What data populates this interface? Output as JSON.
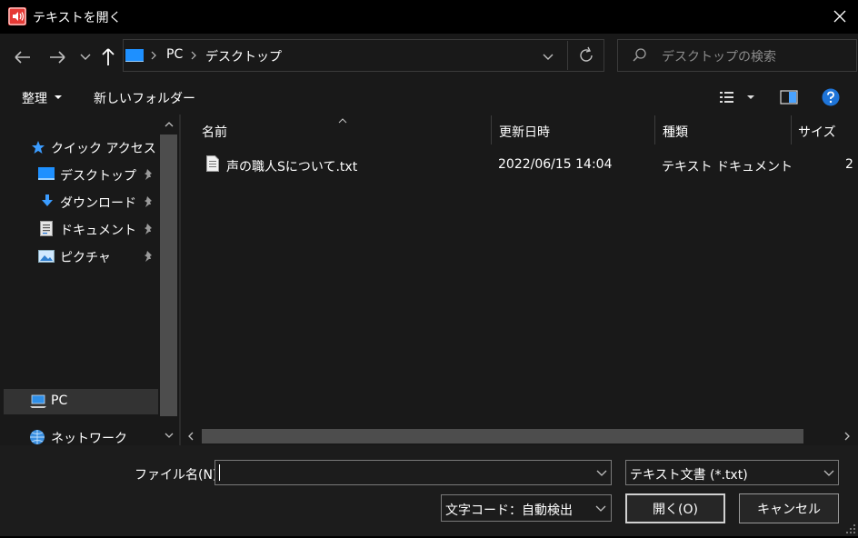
{
  "window": {
    "title": "テキストを開く"
  },
  "nav": {
    "breadcrumb": [
      "PC",
      "デスクトップ"
    ],
    "search_placeholder": "デスクトップの検索"
  },
  "toolbar": {
    "organize": "整理",
    "new_folder": "新しいフォルダー"
  },
  "sidebar": {
    "quick_access": "クイック アクセス",
    "items": [
      "デスクトップ",
      "ダウンロード",
      "ドキュメント",
      "ピクチャ"
    ],
    "pc": "PC",
    "network": "ネットワーク"
  },
  "columns": {
    "name": "名前",
    "date": "更新日時",
    "type": "種類",
    "size": "サイズ"
  },
  "files": [
    {
      "name": "声の職人Sについて.txt",
      "date": "2022/06/15 14:04",
      "type": "テキスト ドキュメント",
      "size": "2"
    }
  ],
  "bottom": {
    "filename_label": "ファイル名(N):",
    "filename_value": "",
    "filter": "テキスト文書 (*.txt)",
    "encoding": "文字コード：自動検出",
    "open": "開く(O)",
    "cancel": "キャンセル"
  }
}
